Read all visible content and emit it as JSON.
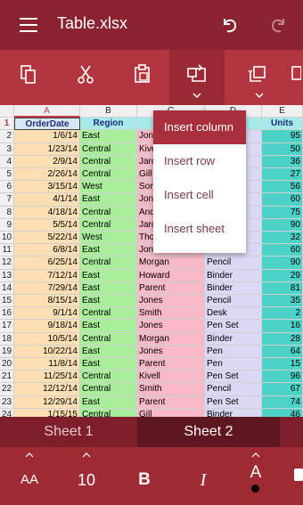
{
  "app": {
    "title": "Table.xlsx"
  },
  "ribbon": {
    "items": [
      "copy",
      "cut",
      "paste",
      "insert",
      "format"
    ]
  },
  "grid": {
    "column_letters": [
      "A",
      "B",
      "C",
      "D",
      "E"
    ],
    "headers": [
      "OrderDate",
      "Region",
      "",
      "",
      "Units"
    ],
    "rows": [
      {
        "n": "2",
        "a": "1/6/14",
        "b": "East",
        "c": "Jone",
        "d": "",
        "e": "95"
      },
      {
        "n": "3",
        "a": "1/23/14",
        "b": "Central",
        "c": "Kive",
        "d": "",
        "e": "50"
      },
      {
        "n": "4",
        "a": "2/9/14",
        "b": "Central",
        "c": "Jarc",
        "d": "",
        "e": "36"
      },
      {
        "n": "5",
        "a": "2/26/14",
        "b": "Central",
        "c": "Gill",
        "d": "",
        "e": "27"
      },
      {
        "n": "6",
        "a": "3/15/14",
        "b": "West",
        "c": "Sorv",
        "d": "",
        "e": "56"
      },
      {
        "n": "7",
        "a": "4/1/14",
        "b": "East",
        "c": "Jone",
        "d": "",
        "e": "60"
      },
      {
        "n": "8",
        "a": "4/18/14",
        "b": "Central",
        "c": "Andr",
        "d": "",
        "e": "75"
      },
      {
        "n": "9",
        "a": "5/5/14",
        "b": "Central",
        "c": "Jarc",
        "d": "",
        "e": "90"
      },
      {
        "n": "10",
        "a": "5/22/14",
        "b": "West",
        "c": "Tho",
        "d": "",
        "e": "32"
      },
      {
        "n": "11",
        "a": "6/8/14",
        "b": "East",
        "c": "Jones",
        "d": "Binder",
        "e": "60"
      },
      {
        "n": "12",
        "a": "6/25/14",
        "b": "Central",
        "c": "Morgan",
        "d": "Pencil",
        "e": "90"
      },
      {
        "n": "13",
        "a": "7/12/14",
        "b": "East",
        "c": "Howard",
        "d": "Binder",
        "e": "29"
      },
      {
        "n": "14",
        "a": "7/29/14",
        "b": "East",
        "c": "Parent",
        "d": "Binder",
        "e": "81"
      },
      {
        "n": "15",
        "a": "8/15/14",
        "b": "East",
        "c": "Jones",
        "d": "Pencil",
        "e": "35"
      },
      {
        "n": "16",
        "a": "9/1/14",
        "b": "Central",
        "c": "Smith",
        "d": "Desk",
        "e": "2"
      },
      {
        "n": "17",
        "a": "9/18/14",
        "b": "East",
        "c": "Jones",
        "d": "Pen Set",
        "e": "16"
      },
      {
        "n": "18",
        "a": "10/5/14",
        "b": "Central",
        "c": "Morgan",
        "d": "Binder",
        "e": "28"
      },
      {
        "n": "19",
        "a": "10/22/14",
        "b": "East",
        "c": "Jones",
        "d": "Pen",
        "e": "64"
      },
      {
        "n": "20",
        "a": "11/8/14",
        "b": "East",
        "c": "Parent",
        "d": "Pen",
        "e": "15"
      },
      {
        "n": "21",
        "a": "11/25/14",
        "b": "Central",
        "c": "Kivell",
        "d": "Pen Set",
        "e": "96"
      },
      {
        "n": "22",
        "a": "12/12/14",
        "b": "Central",
        "c": "Smith",
        "d": "Pencil",
        "e": "67"
      },
      {
        "n": "23",
        "a": "12/29/14",
        "b": "East",
        "c": "Parent",
        "d": "Pen Set",
        "e": "74"
      },
      {
        "n": "24",
        "a": "1/15/15",
        "b": "Central",
        "c": "Gill",
        "d": "Binder",
        "e": "46"
      }
    ]
  },
  "context_menu": {
    "items": [
      "Insert column",
      "Insert row",
      "Insert cell",
      "Insert sheet"
    ],
    "selected": "Insert column"
  },
  "tabs": [
    "Sheet 1",
    "Sheet 2"
  ],
  "active_tab": "Sheet 2",
  "format_bar": {
    "font_size_label": "AA",
    "font_size": "10",
    "bold_label": "B",
    "italic_label": "I",
    "font_color_label": "A"
  }
}
